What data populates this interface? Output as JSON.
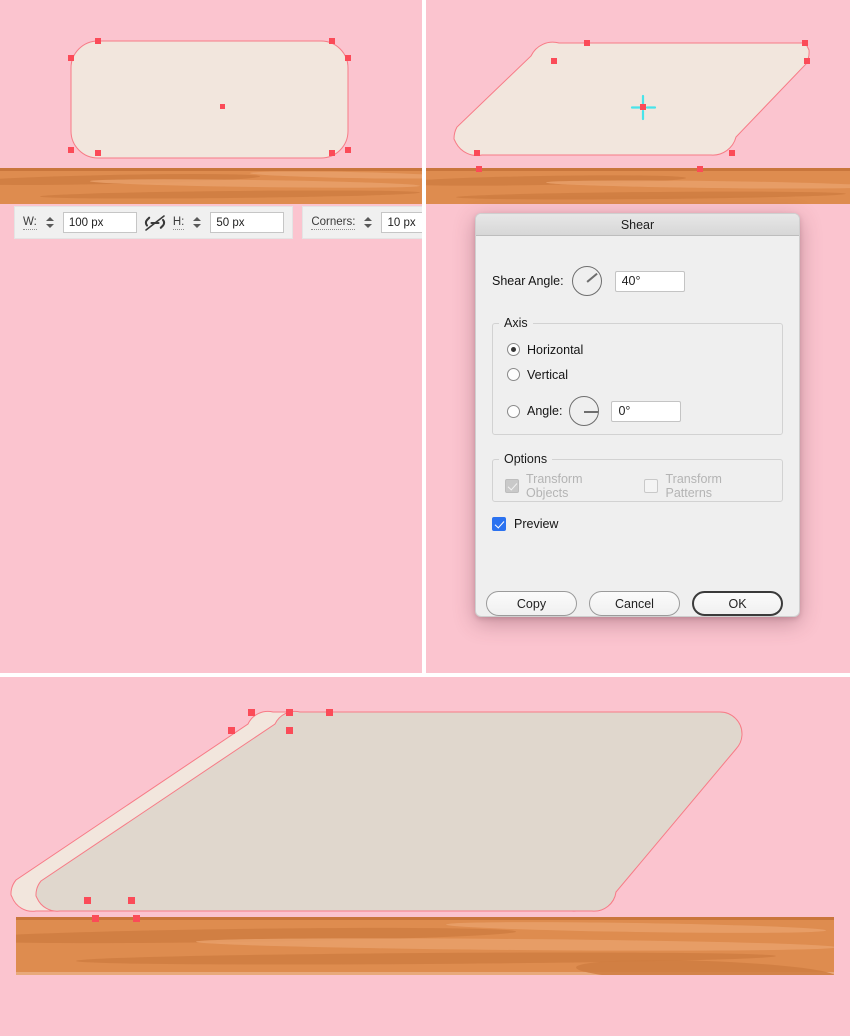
{
  "canvas": {
    "background_pink": "#fbc4cf",
    "plank_color": "#de8c4f",
    "shape_fill_light": "#f2e6dd",
    "shape_fill_dark": "#e0d7cd",
    "anchor_color": "#fb4b58",
    "path_color": "#f77b86",
    "origin_crosshair_color": "#49e4ea"
  },
  "toolbar": {
    "width_label": "W:",
    "width_value": "100 px",
    "link_icon": "broken-chain-icon",
    "height_label": "H:",
    "height_value": "50 px",
    "corners_label": "Corners:",
    "corners_value": "10 px"
  },
  "dialog": {
    "title": "Shear",
    "shear_angle": {
      "label": "Shear Angle:",
      "value": "40°",
      "dial_degrees": 40
    },
    "axis": {
      "legend": "Axis",
      "options": [
        {
          "label": "Horizontal",
          "selected": true
        },
        {
          "label": "Vertical",
          "selected": false
        },
        {
          "label": "Angle:",
          "selected": false
        }
      ],
      "angle_value": "0°",
      "angle_dial_degrees": 0
    },
    "options": {
      "legend": "Options",
      "items": [
        {
          "label": "Transform Objects",
          "checked": true,
          "enabled": false
        },
        {
          "label": "Transform Patterns",
          "checked": false,
          "enabled": false
        }
      ]
    },
    "preview": {
      "label": "Preview",
      "checked": true,
      "accent": "#2b72f0"
    },
    "buttons": [
      {
        "label": "Copy",
        "default": false
      },
      {
        "label": "Cancel",
        "default": false
      },
      {
        "label": "OK",
        "default": true
      }
    ]
  },
  "panels": [
    {
      "name": "before-shape",
      "caption": ""
    },
    {
      "name": "shear-dialog-preview",
      "caption": ""
    },
    {
      "name": "after-shape-result",
      "caption": ""
    }
  ]
}
